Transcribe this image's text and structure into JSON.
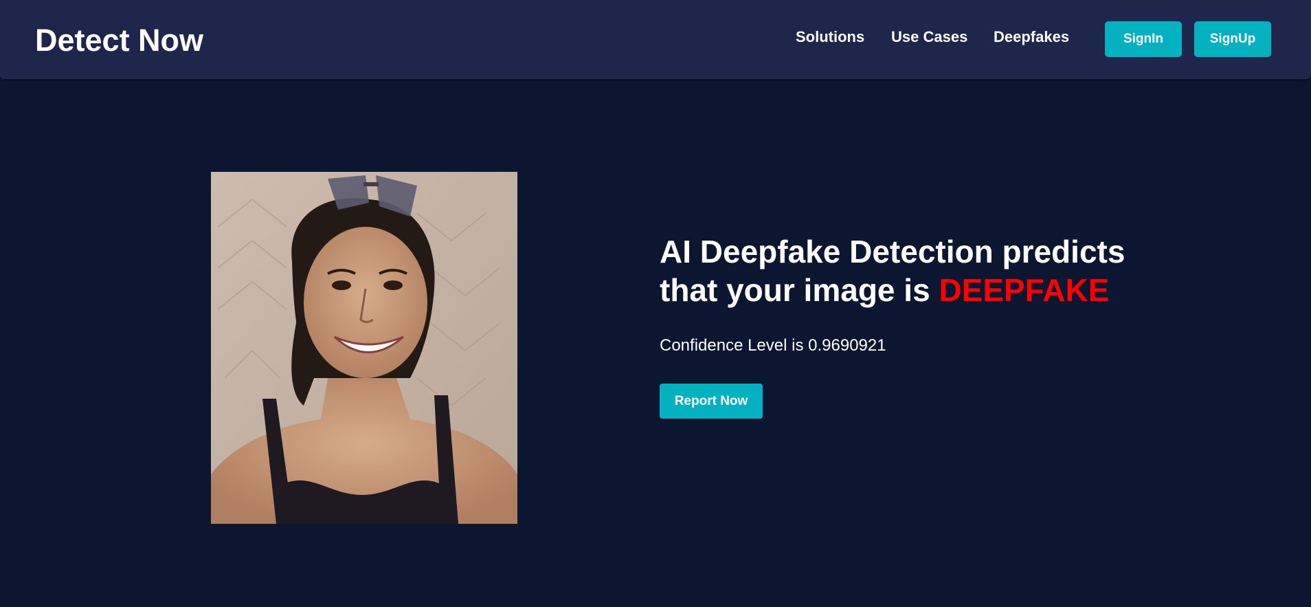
{
  "brand": {
    "title": "Detect Now"
  },
  "nav": {
    "links": [
      "Solutions",
      "Use Cases",
      "Deepfakes"
    ],
    "signin_label": "SignIn",
    "signup_label": "SignUp"
  },
  "result": {
    "headline_prefix": "AI Deepfake Detection predicts that your image is",
    "verdict": "DEEPFAKE",
    "confidence_text": "Confidence Level is 0.9690921",
    "report_label": "Report Now"
  },
  "colors": {
    "page_background": "#0c1631",
    "navbar_background": "#1e274b",
    "accent": "#03b1c1",
    "verdict": "#ff0000"
  }
}
